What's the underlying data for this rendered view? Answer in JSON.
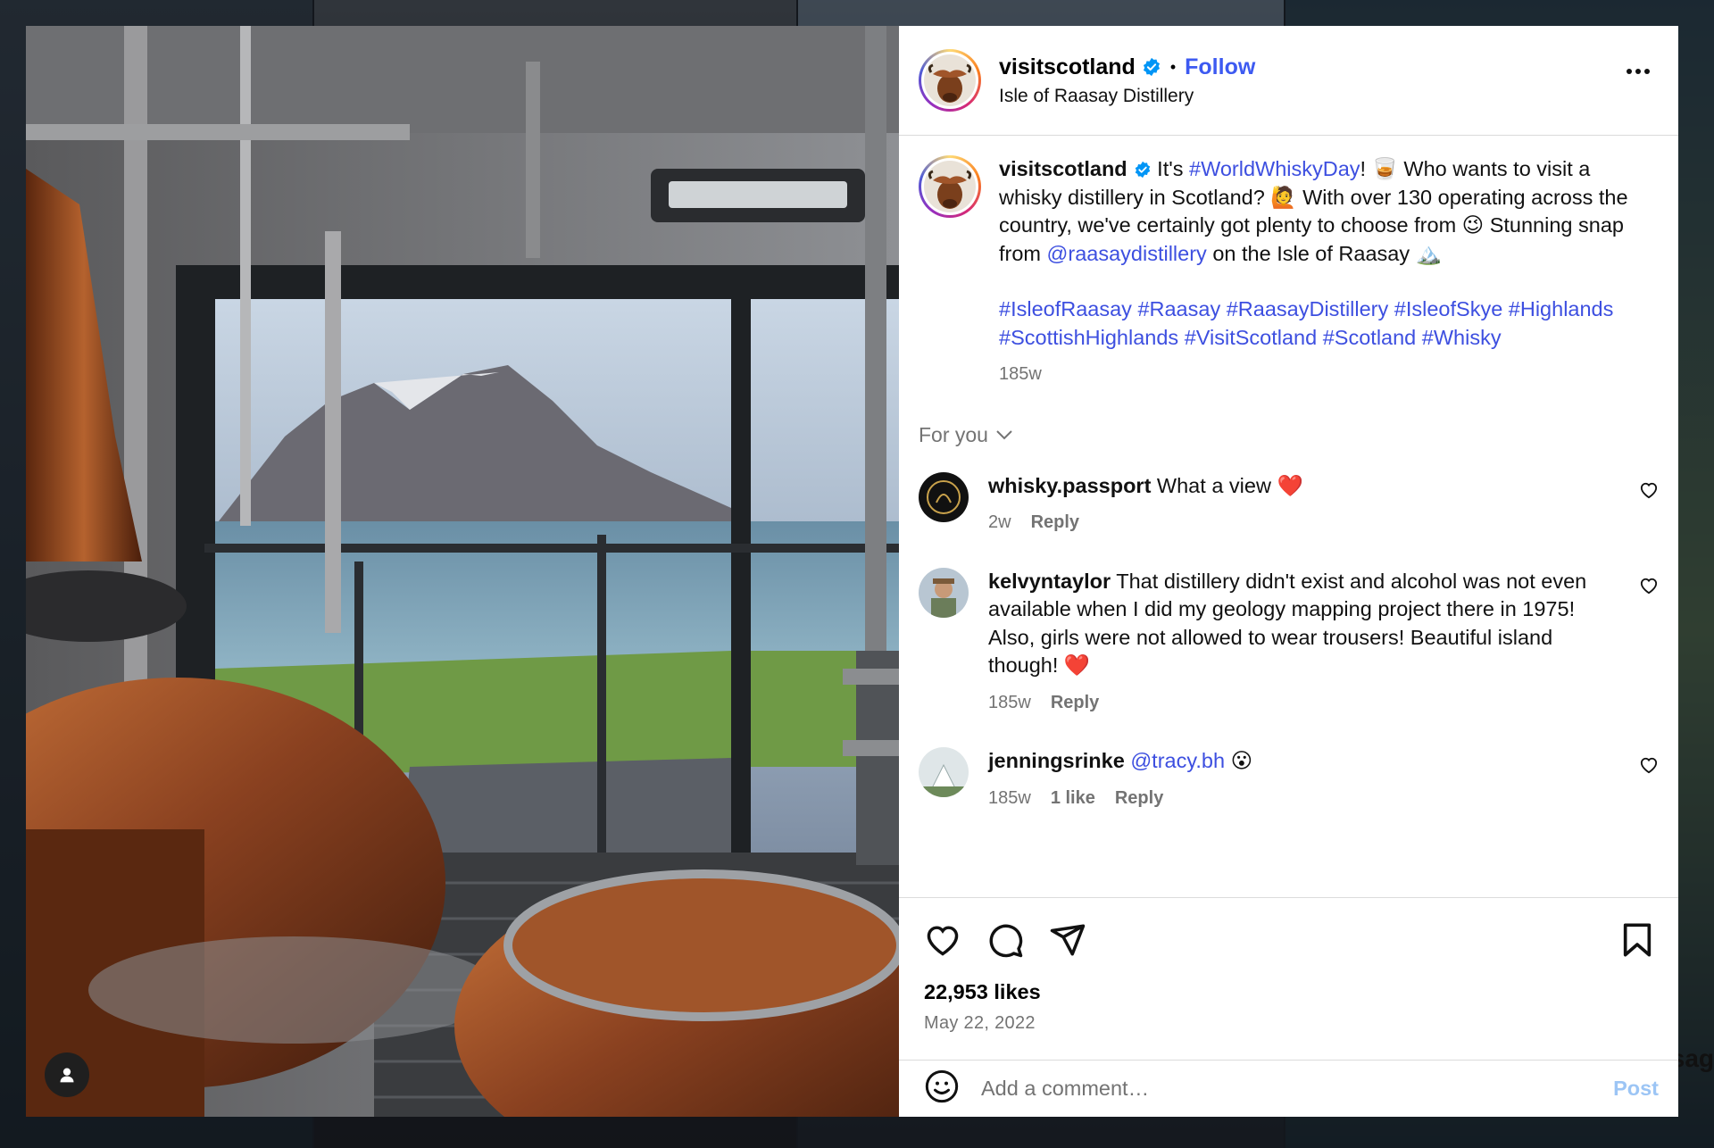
{
  "post": {
    "username": "visitscotland",
    "follow_label": "Follow",
    "location": "Isle of Raasay Distillery",
    "caption": {
      "username": "visitscotland",
      "text_1": " It's ",
      "hashtag_1": "#WorldWhiskyDay",
      "text_2": "! 🥃 Who wants to visit a whisky distillery in Scotland? 🙋 With over 130 operating across the country, we've certainly got plenty to choose from 😉 Stunning snap from ",
      "mention": "@raasaydistillery",
      "text_3": " on the Isle of Raasay 🏔️",
      "hashtags": "#IsleofRaasay #Raasay #RaasayDistillery #IsleofSkye #Highlands #ScottishHighlands #VisitScotland #Scotland #Whisky",
      "time": "185w"
    },
    "for_you_label": "For you",
    "comments": [
      {
        "username": "whisky.passport",
        "text": " What a view ❤️",
        "time": "2w",
        "reply": "Reply"
      },
      {
        "username": "kelvyntaylor",
        "text": " That distillery didn't exist and alcohol was not even available when I did my geology mapping project there in 1975! Also, girls were not allowed to wear trousers! Beautiful island though! ❤️",
        "time": "185w",
        "reply": "Reply"
      },
      {
        "username": "jenningsrinke",
        "mention": "@tracy.bh",
        "emoji": " 😮",
        "time": "185w",
        "likes": "1 like",
        "reply": "Reply"
      }
    ],
    "likes": "22,953 likes",
    "date": "May 22, 2022",
    "add_comment_placeholder": "Add a comment…",
    "post_label": "Post",
    "partial_text_right": "sag"
  },
  "colors": {
    "link_blue": "#3d4fe0",
    "follow_blue": "#3d5af1",
    "verified_blue": "#0095f6",
    "muted": "#737373"
  }
}
